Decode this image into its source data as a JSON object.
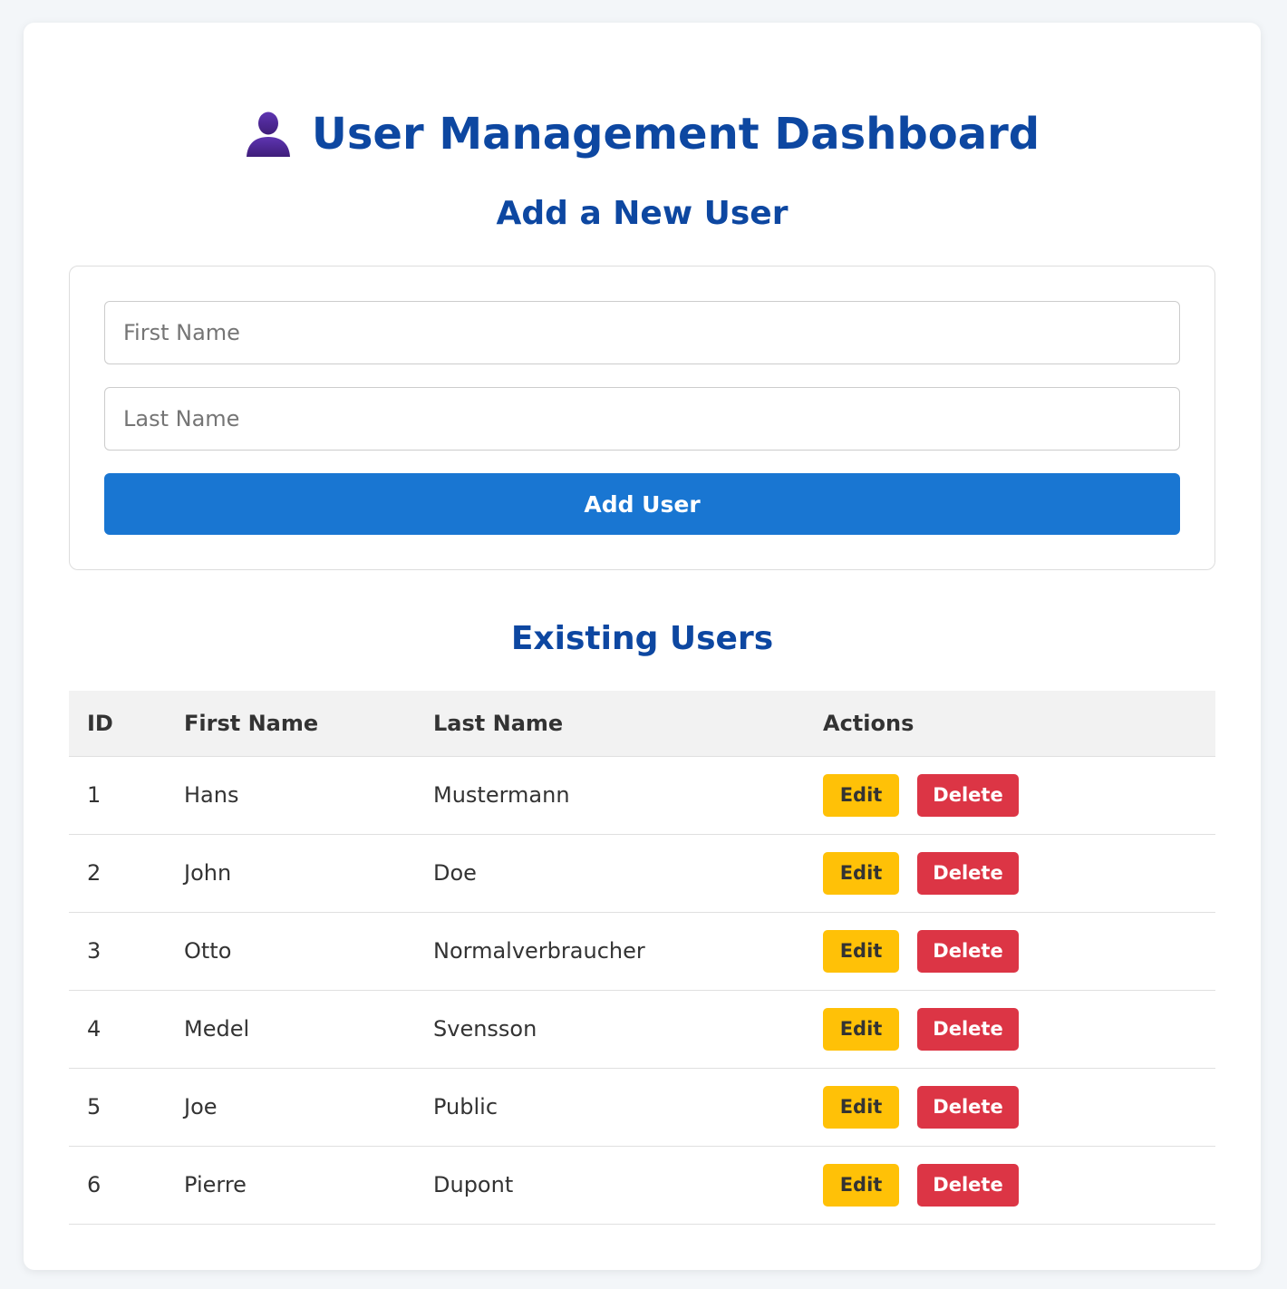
{
  "header": {
    "title": "User Management Dashboard",
    "icon": "user-icon",
    "title_color": "#0d47a1"
  },
  "add_form": {
    "heading": "Add a New User",
    "first_name_placeholder": "First Name",
    "first_name_value": "",
    "last_name_placeholder": "Last Name",
    "last_name_value": "",
    "submit_label": "Add User",
    "submit_color": "#1976d2"
  },
  "users_section": {
    "heading": "Existing Users",
    "columns": [
      "ID",
      "First Name",
      "Last Name",
      "Actions"
    ],
    "edit_label": "Edit",
    "delete_label": "Delete",
    "edit_color": "#ffc107",
    "delete_color": "#dc3545",
    "rows": [
      {
        "id": "1",
        "first": "Hans",
        "last": "Mustermann"
      },
      {
        "id": "2",
        "first": "John",
        "last": "Doe"
      },
      {
        "id": "3",
        "first": "Otto",
        "last": "Normalverbraucher"
      },
      {
        "id": "4",
        "first": "Medel",
        "last": "Svensson"
      },
      {
        "id": "5",
        "first": "Joe",
        "last": "Public"
      },
      {
        "id": "6",
        "first": "Pierre",
        "last": "Dupont"
      }
    ]
  }
}
